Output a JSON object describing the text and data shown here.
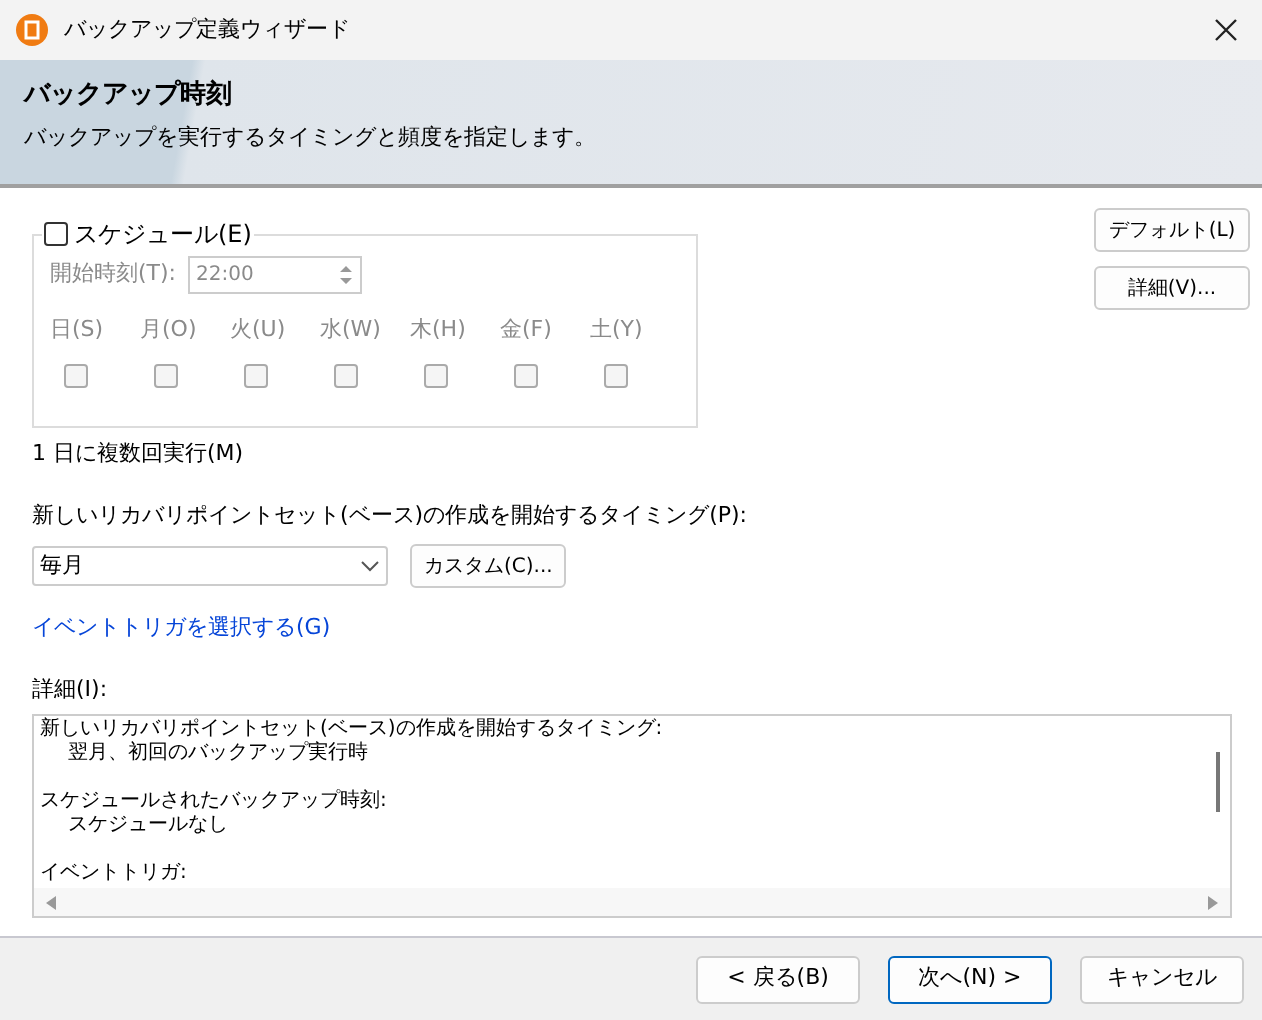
{
  "window": {
    "title": "バックアップ定義ウィザード"
  },
  "header": {
    "title": "バックアップ時刻",
    "subtitle": "バックアップを実行するタイミングと頻度を指定します。"
  },
  "schedule": {
    "label": "スケジュール(E)",
    "checked": false,
    "start_time_label": "開始時刻(T):",
    "start_time": "22:00",
    "days": [
      {
        "label": "日(S)",
        "checked": false
      },
      {
        "label": "月(O)",
        "checked": false
      },
      {
        "label": "火(U)",
        "checked": false
      },
      {
        "label": "水(W)",
        "checked": false
      },
      {
        "label": "木(H)",
        "checked": false
      },
      {
        "label": "金(F)",
        "checked": false
      },
      {
        "label": "土(Y)",
        "checked": false
      }
    ]
  },
  "side_buttons": [
    "デフォルト(L)",
    "詳細(V)..."
  ],
  "multiple_runs": "1 日に複数回実行(M)",
  "timing_label": "新しいリカバリポイントセット(ベース)の作成を開始するタイミング(P):",
  "timing_select": "毎月",
  "custom_button": "カスタム(C)...",
  "event_link": "イベントトリガを選択する(G)",
  "details_label": "詳細(I):",
  "details_sections": [
    {
      "heading": "新しいリカバリポイントセット(ベース)の作成を開始するタイミング:",
      "value": "翌月、初回のバックアップ実行時"
    },
    {
      "heading": "スケジュールされたバックアップ時刻:",
      "value": "スケジュールなし"
    },
    {
      "heading": "イベントトリガ:"
    }
  ],
  "footer_buttons": [
    {
      "label": "< 戻る(B)",
      "selected": false
    },
    {
      "label": "次へ(N) >",
      "selected": true
    },
    {
      "label": "キャンセル",
      "selected": false
    }
  ]
}
